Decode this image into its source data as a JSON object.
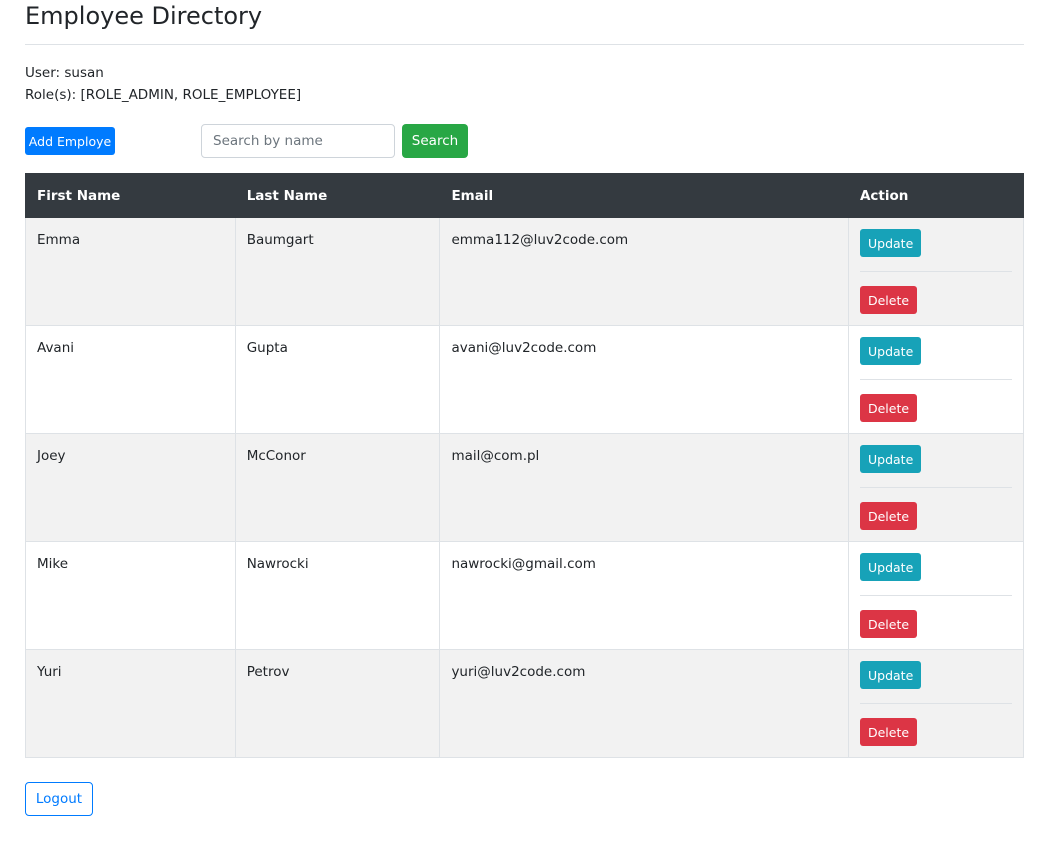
{
  "page": {
    "title": "Employee Directory"
  },
  "user": {
    "user_line": "User: susan",
    "roles_line": "Role(s): [ROLE_ADMIN, ROLE_EMPLOYEE]"
  },
  "toolbar": {
    "add_label": "Add Employe",
    "search_placeholder": "Search by name",
    "search_value": "",
    "search_label": "Search"
  },
  "table": {
    "headers": {
      "first_name": "First Name",
      "last_name": "Last Name",
      "email": "Email",
      "action": "Action"
    },
    "rows": [
      {
        "first_name": "Emma",
        "last_name": "Baumgart",
        "email": "emma112@luv2code.com",
        "update_label": "Update",
        "delete_label": "Delete"
      },
      {
        "first_name": "Avani",
        "last_name": "Gupta",
        "email": "avani@luv2code.com",
        "update_label": "Update",
        "delete_label": "Delete"
      },
      {
        "first_name": "Joey",
        "last_name": "McConor",
        "email": "mail@com.pl",
        "update_label": "Update",
        "delete_label": "Delete"
      },
      {
        "first_name": "Mike",
        "last_name": "Nawrocki",
        "email": "nawrocki@gmail.com",
        "update_label": "Update",
        "delete_label": "Delete"
      },
      {
        "first_name": "Yuri",
        "last_name": "Petrov",
        "email": "yuri@luv2code.com",
        "update_label": "Update",
        "delete_label": "Delete"
      }
    ]
  },
  "footer": {
    "logout_label": "Logout"
  },
  "colors": {
    "primary": "#007bff",
    "success": "#28a745",
    "info": "#17a2b8",
    "danger": "#dc3545",
    "header_dark": "#343a40",
    "stripe": "#f2f2f2"
  }
}
